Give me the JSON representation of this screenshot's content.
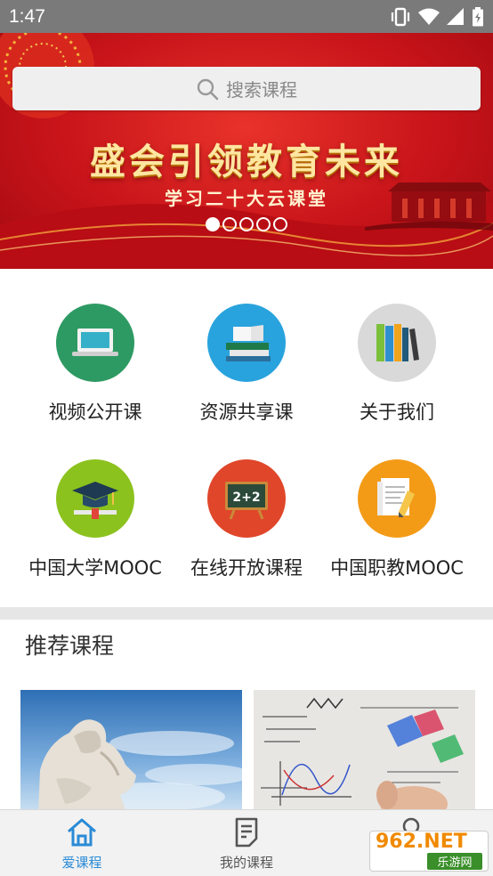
{
  "status_bar": {
    "time": "1:47"
  },
  "banner": {
    "search_placeholder": "搜索课程",
    "title": "盛会引领教育未来",
    "subtitle": "学习二十大云课堂",
    "dots_total": 5,
    "dots_active": 1
  },
  "grid": {
    "items": [
      {
        "label": "视频公开课",
        "icon": "laptop-icon",
        "color": "#2e9a63"
      },
      {
        "label": "资源共享课",
        "icon": "books-stack-icon",
        "color": "#29a3dd"
      },
      {
        "label": "关于我们",
        "icon": "bookshelf-icon",
        "color": "#d9d9d9"
      },
      {
        "label": "中国大学MOOC",
        "icon": "graduation-cap-icon",
        "color": "#8cc21e"
      },
      {
        "label": "在线开放课程",
        "icon": "blackboard-icon",
        "color": "#e0462a"
      },
      {
        "label": "中国职教MOOC",
        "icon": "notes-pencil-icon",
        "color": "#f39b17"
      }
    ]
  },
  "recommended": {
    "title": "推荐课程"
  },
  "bottom_nav": {
    "items": [
      {
        "label": "爱课程",
        "icon": "home-icon",
        "active": true
      },
      {
        "label": "我的课程",
        "icon": "document-icon",
        "active": false
      },
      {
        "label": "",
        "icon": "user-icon",
        "active": false
      }
    ],
    "active_color": "#2a8bd6"
  },
  "watermark": {
    "logo": "962.NET",
    "sub": "乐游网"
  }
}
